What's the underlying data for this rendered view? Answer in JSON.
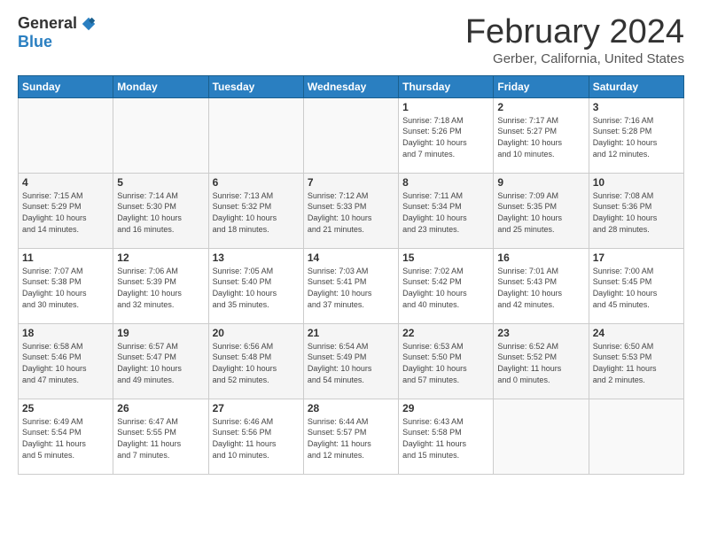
{
  "header": {
    "logo_general": "General",
    "logo_blue": "Blue",
    "month_title": "February 2024",
    "location": "Gerber, California, United States"
  },
  "days_of_week": [
    "Sunday",
    "Monday",
    "Tuesday",
    "Wednesday",
    "Thursday",
    "Friday",
    "Saturday"
  ],
  "weeks": [
    [
      {
        "day": "",
        "info": ""
      },
      {
        "day": "",
        "info": ""
      },
      {
        "day": "",
        "info": ""
      },
      {
        "day": "",
        "info": ""
      },
      {
        "day": "1",
        "info": "Sunrise: 7:18 AM\nSunset: 5:26 PM\nDaylight: 10 hours\nand 7 minutes."
      },
      {
        "day": "2",
        "info": "Sunrise: 7:17 AM\nSunset: 5:27 PM\nDaylight: 10 hours\nand 10 minutes."
      },
      {
        "day": "3",
        "info": "Sunrise: 7:16 AM\nSunset: 5:28 PM\nDaylight: 10 hours\nand 12 minutes."
      }
    ],
    [
      {
        "day": "4",
        "info": "Sunrise: 7:15 AM\nSunset: 5:29 PM\nDaylight: 10 hours\nand 14 minutes."
      },
      {
        "day": "5",
        "info": "Sunrise: 7:14 AM\nSunset: 5:30 PM\nDaylight: 10 hours\nand 16 minutes."
      },
      {
        "day": "6",
        "info": "Sunrise: 7:13 AM\nSunset: 5:32 PM\nDaylight: 10 hours\nand 18 minutes."
      },
      {
        "day": "7",
        "info": "Sunrise: 7:12 AM\nSunset: 5:33 PM\nDaylight: 10 hours\nand 21 minutes."
      },
      {
        "day": "8",
        "info": "Sunrise: 7:11 AM\nSunset: 5:34 PM\nDaylight: 10 hours\nand 23 minutes."
      },
      {
        "day": "9",
        "info": "Sunrise: 7:09 AM\nSunset: 5:35 PM\nDaylight: 10 hours\nand 25 minutes."
      },
      {
        "day": "10",
        "info": "Sunrise: 7:08 AM\nSunset: 5:36 PM\nDaylight: 10 hours\nand 28 minutes."
      }
    ],
    [
      {
        "day": "11",
        "info": "Sunrise: 7:07 AM\nSunset: 5:38 PM\nDaylight: 10 hours\nand 30 minutes."
      },
      {
        "day": "12",
        "info": "Sunrise: 7:06 AM\nSunset: 5:39 PM\nDaylight: 10 hours\nand 32 minutes."
      },
      {
        "day": "13",
        "info": "Sunrise: 7:05 AM\nSunset: 5:40 PM\nDaylight: 10 hours\nand 35 minutes."
      },
      {
        "day": "14",
        "info": "Sunrise: 7:03 AM\nSunset: 5:41 PM\nDaylight: 10 hours\nand 37 minutes."
      },
      {
        "day": "15",
        "info": "Sunrise: 7:02 AM\nSunset: 5:42 PM\nDaylight: 10 hours\nand 40 minutes."
      },
      {
        "day": "16",
        "info": "Sunrise: 7:01 AM\nSunset: 5:43 PM\nDaylight: 10 hours\nand 42 minutes."
      },
      {
        "day": "17",
        "info": "Sunrise: 7:00 AM\nSunset: 5:45 PM\nDaylight: 10 hours\nand 45 minutes."
      }
    ],
    [
      {
        "day": "18",
        "info": "Sunrise: 6:58 AM\nSunset: 5:46 PM\nDaylight: 10 hours\nand 47 minutes."
      },
      {
        "day": "19",
        "info": "Sunrise: 6:57 AM\nSunset: 5:47 PM\nDaylight: 10 hours\nand 49 minutes."
      },
      {
        "day": "20",
        "info": "Sunrise: 6:56 AM\nSunset: 5:48 PM\nDaylight: 10 hours\nand 52 minutes."
      },
      {
        "day": "21",
        "info": "Sunrise: 6:54 AM\nSunset: 5:49 PM\nDaylight: 10 hours\nand 54 minutes."
      },
      {
        "day": "22",
        "info": "Sunrise: 6:53 AM\nSunset: 5:50 PM\nDaylight: 10 hours\nand 57 minutes."
      },
      {
        "day": "23",
        "info": "Sunrise: 6:52 AM\nSunset: 5:52 PM\nDaylight: 11 hours\nand 0 minutes."
      },
      {
        "day": "24",
        "info": "Sunrise: 6:50 AM\nSunset: 5:53 PM\nDaylight: 11 hours\nand 2 minutes."
      }
    ],
    [
      {
        "day": "25",
        "info": "Sunrise: 6:49 AM\nSunset: 5:54 PM\nDaylight: 11 hours\nand 5 minutes."
      },
      {
        "day": "26",
        "info": "Sunrise: 6:47 AM\nSunset: 5:55 PM\nDaylight: 11 hours\nand 7 minutes."
      },
      {
        "day": "27",
        "info": "Sunrise: 6:46 AM\nSunset: 5:56 PM\nDaylight: 11 hours\nand 10 minutes."
      },
      {
        "day": "28",
        "info": "Sunrise: 6:44 AM\nSunset: 5:57 PM\nDaylight: 11 hours\nand 12 minutes."
      },
      {
        "day": "29",
        "info": "Sunrise: 6:43 AM\nSunset: 5:58 PM\nDaylight: 11 hours\nand 15 minutes."
      },
      {
        "day": "",
        "info": ""
      },
      {
        "day": "",
        "info": ""
      }
    ]
  ]
}
